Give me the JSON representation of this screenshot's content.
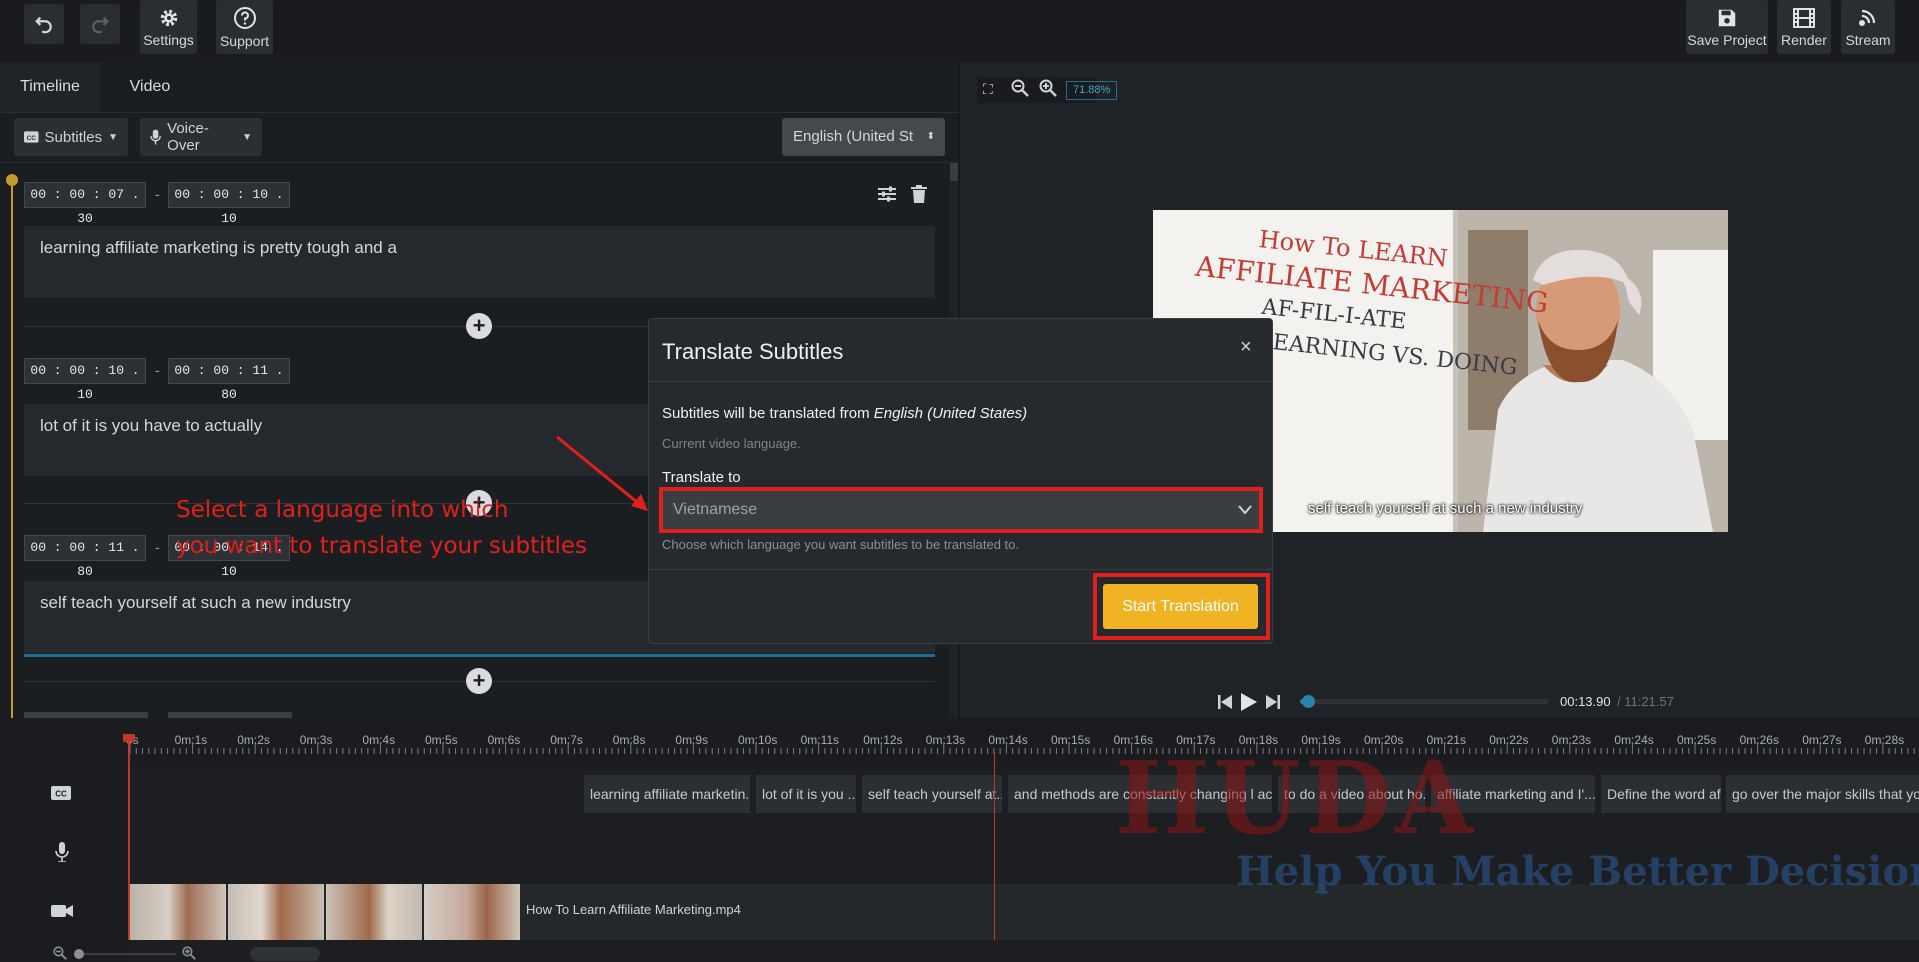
{
  "toolbar": {
    "settings_label": "Settings",
    "support_label": "Support",
    "save_project_label": "Save Project",
    "render_label": "Render",
    "stream_label": "Stream"
  },
  "tabs": {
    "timeline": "Timeline",
    "video": "Video"
  },
  "controls": {
    "subtitles_label": "Subtitles",
    "voiceover_label": "Voice-Over",
    "language_value": "English (United St",
    "zoom_level": "71.88%"
  },
  "subtitles": [
    {
      "start": "00 : 00 : 07 . 30",
      "end": "00 : 00 : 10 . 10",
      "text": "learning affiliate marketing is pretty tough and a"
    },
    {
      "start": "00 : 00 : 10 . 10",
      "end": "00 : 00 : 11 . 80",
      "text": "lot of it is you have to actually"
    },
    {
      "start": "00 : 00 : 11 . 80",
      "end": "00 : 00 : 14 . 10",
      "text": "self teach yourself at such a new industry"
    }
  ],
  "annotation": {
    "line1": "Select a language into which",
    "line2": "you want to translate your subtitles",
    "color": "#e0201c"
  },
  "modal": {
    "title": "Translate Subtitles",
    "from_prefix": "Subtitles will be translated from ",
    "from_language": "English (United States)",
    "current_lang_note": "Current video language.",
    "translate_to_label": "Translate to",
    "selected_language": "Vietnamese",
    "help_text": "Choose which language you want subtitles to be translated to.",
    "start_button": "Start Translation",
    "button_color": "#f0b323"
  },
  "video": {
    "caption": "self teach yourself at such a new industry",
    "board_text": [
      "How To LEARN",
      "AFFILIATE MARKETING",
      "AF-FIL-I-ATE",
      "LEARNING VS. DOING"
    ]
  },
  "player": {
    "current_time": "00:13.90",
    "total_time": "/ 11:21.57",
    "progress": 0.02
  },
  "ruler_ticks": [
    "0s",
    "0m:1s",
    "0m:2s",
    "0m:3s",
    "0m:4s",
    "0m:5s",
    "0m:6s",
    "0m:7s",
    "0m:8s",
    "0m:9s",
    "0m:10s",
    "0m:11s",
    "0m:12s",
    "0m:13s",
    "0m:14s",
    "0m:15s",
    "0m:16s",
    "0m:17s",
    "0m:18s",
    "0m:19s",
    "0m:20s",
    "0m:21s",
    "0m:22s",
    "0m:23s",
    "0m:24s",
    "0m:25s",
    "0m:26s",
    "0m:27s",
    "0m:28s"
  ],
  "subtitle_chips": [
    "learning affiliate marketin...",
    "lot of it is you ...",
    "self teach yourself at...",
    "and methods are constantly changing l act...",
    "to do a video about ho...",
    "affiliate marketing and I'...",
    "Define the word af...",
    "go over the major skills that you..."
  ],
  "video_clip_label": "How To Learn Affiliate Marketing.mp4",
  "watermark": {
    "brand": "HUDA",
    "tagline": "Help You Make Better Decisions"
  }
}
